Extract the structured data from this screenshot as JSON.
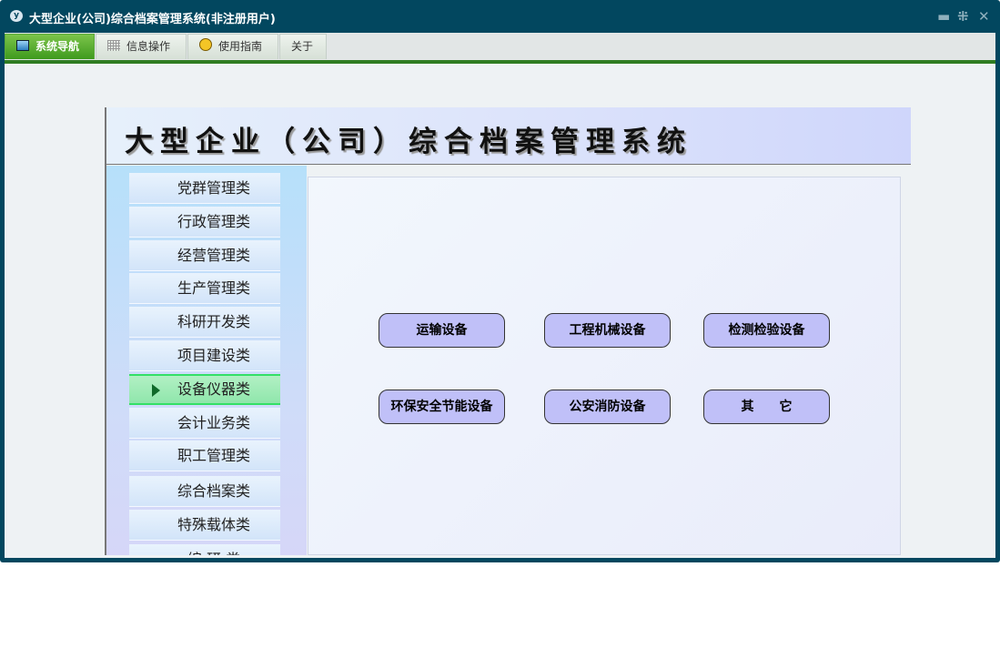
{
  "window": {
    "title": "大型企业(公司)综合档案管理系统(非注册用户)",
    "app_icon": "y"
  },
  "window_controls": {
    "minimize": "▬",
    "restore": "⁜",
    "close": "✕"
  },
  "toolbar": {
    "tabs": [
      {
        "label": "系统导航",
        "icon": "monitor-icon",
        "active": true
      },
      {
        "label": "信息操作",
        "icon": "grid-icon"
      },
      {
        "label": "使用指南",
        "icon": "help-icon"
      },
      {
        "label": "关于"
      }
    ]
  },
  "banner": {
    "title": "大型企业（公司）综合档案管理系统"
  },
  "sidebar": {
    "items": [
      "党群管理类",
      "行政管理类",
      "经营管理类",
      "生产管理类",
      "科研开发类",
      "项目建设类",
      "设备仪器类",
      "会计业务类",
      "职工管理类",
      "综合档案类",
      "特殊载体类",
      "编 研 类"
    ],
    "active_index": 6
  },
  "main": {
    "buttons": [
      "运输设备",
      "工程机械设备",
      "检测检验设备",
      "环保安全节能设备",
      "公安消防设备",
      "其　　它"
    ]
  },
  "colors": {
    "frame": "#02475f",
    "active_tab": "#3e9a1e",
    "button": "#c0c0f8",
    "active_item": "#8fe6ab"
  }
}
